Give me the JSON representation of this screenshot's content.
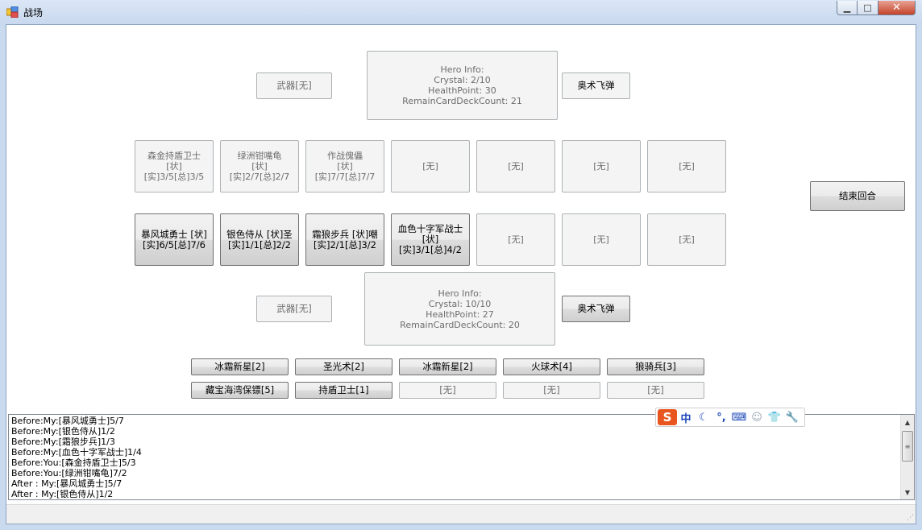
{
  "window": {
    "title": "战场",
    "min_glyph": "▁",
    "max_glyph": "□",
    "close_glyph": "✕"
  },
  "enemy": {
    "weapon": "武器[无]",
    "hero_info": [
      "Hero Info:",
      "Crystal: 2/10",
      "HealthPoint: 30",
      "RemainCardDeckCount: 21"
    ],
    "hero_power": "奥术飞弹",
    "minions": [
      [
        "森金持盾卫士",
        "[状]",
        "[实]3/5[总]3/5"
      ],
      [
        "绿洲钳嘴龟",
        "[状]",
        "[实]2/7[总]2/7"
      ],
      [
        "作战傀儡",
        "[状]",
        "[实]7/7[总]7/7"
      ],
      [
        "[无]"
      ],
      [
        "[无]"
      ],
      [
        "[无]"
      ],
      [
        "[无]"
      ]
    ]
  },
  "my": {
    "minions": [
      [
        "暴风城勇士",
        "[状]",
        "[实]6/5[总]7/6"
      ],
      [
        "银色侍从",
        "[状]圣",
        "[实]1/1[总]2/2"
      ],
      [
        "霜狼步兵",
        "[状]嘲",
        "[实]2/1[总]3/2"
      ],
      [
        "血色十字军战士",
        "[状]",
        "[实]3/1[总]4/2"
      ],
      [
        "[无]"
      ],
      [
        "[无]"
      ],
      [
        "[无]"
      ]
    ],
    "weapon": "武器[无]",
    "hero_info": [
      "Hero Info:",
      "Crystal: 10/10",
      "HealthPoint: 27",
      "RemainCardDeckCount: 20"
    ],
    "hero_power": "奥术飞弹",
    "end_turn": "结束回合",
    "hand_row1": [
      "冰霜新星[2]",
      "圣光术[2]",
      "冰霜新星[2]",
      "火球术[4]",
      "狼骑兵[3]"
    ],
    "hand_row2": [
      "藏宝海湾保镖[5]",
      "持盾卫士[1]",
      "[无]",
      "[无]",
      "[无]"
    ]
  },
  "log": [
    "Before:My:[暴风城勇士]5/7",
    "Before:My:[银色侍从]1/2",
    "Before:My:[霜狼步兵]1/3",
    "Before:My:[血色十字军战士]1/4",
    "Before:You:[森金持盾卫士]5/3",
    "Before:You:[绿洲钳嘴龟]7/2",
    "After : My:[暴风城勇士]5/7",
    "After : My:[银色侍从]1/2"
  ],
  "ime": {
    "logo": "S",
    "items": [
      "中",
      "☾",
      "°,",
      "⌨",
      "☺",
      "👕",
      "🔧"
    ]
  },
  "icons": {
    "app_icon": "app-icon",
    "scroll_up": "▲",
    "scroll_down": "▼",
    "grip": "⋰"
  },
  "colors": {
    "ime_brand": "#e8551e",
    "ime_icons": "#1b47b8"
  }
}
